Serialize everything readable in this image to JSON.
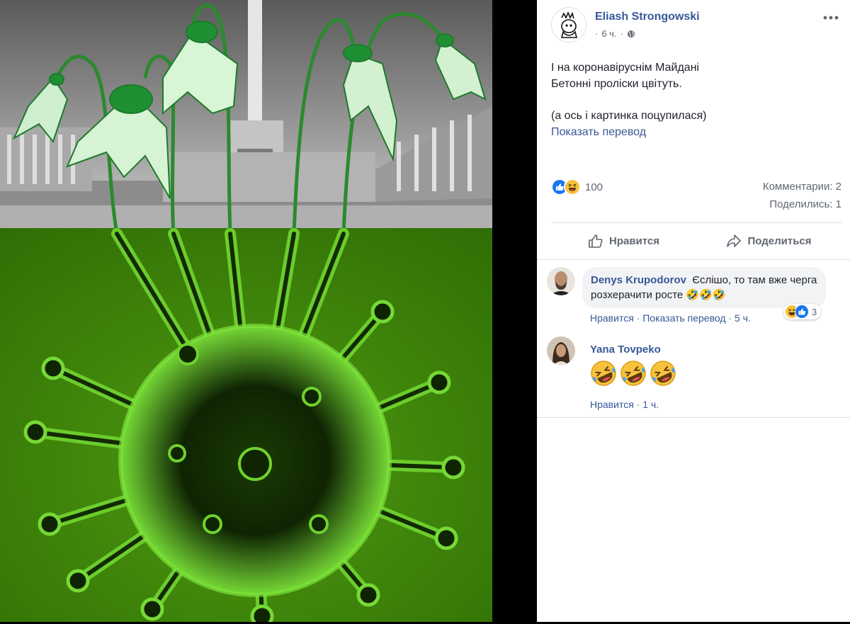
{
  "post": {
    "author": "Eliash Strongowski",
    "time": "6 ч.",
    "separator": "·",
    "text_lines": [
      "І на коронавіруснім Майдані",
      "Бетонні проліски цвітуть."
    ],
    "text_line3": "(а ось і картинка поцупилася)",
    "translate_label": "Показать перевод"
  },
  "stats": {
    "reactions_count": "100",
    "comments_label": "Комментарии: 2",
    "shares_label": "Поделились: 1"
  },
  "actions": {
    "like_label": "Нравится",
    "share_label": "Поделиться"
  },
  "comments": [
    {
      "author": "Denys Krupodorov",
      "text": "Єслішо, то там вже черга розхерачити росте 🤣🤣🤣",
      "like_label": "Нравится",
      "sep": "·",
      "translate_label": "Показать перевод",
      "time": "5 ч.",
      "reaction_count": "3"
    },
    {
      "author": "Yana Tovpeko",
      "like_label": "Нравится",
      "sep": "·",
      "time": "1 ч."
    }
  ],
  "icons": {
    "more": "more-dots-icon",
    "globe": "globe-icon",
    "like": "thumbs-up-icon",
    "share": "share-arrow-icon",
    "reaction_like": "like-reaction-icon",
    "reaction_haha": "haha-reaction-icon",
    "emoji_laugh": "rolling-laughing-emoji"
  },
  "colors": {
    "link_blue": "#385898",
    "like_blue": "#1877f2",
    "secondary_text": "#606770",
    "virus_green": "#6fd12e",
    "background_green": "#3f8a0a"
  }
}
